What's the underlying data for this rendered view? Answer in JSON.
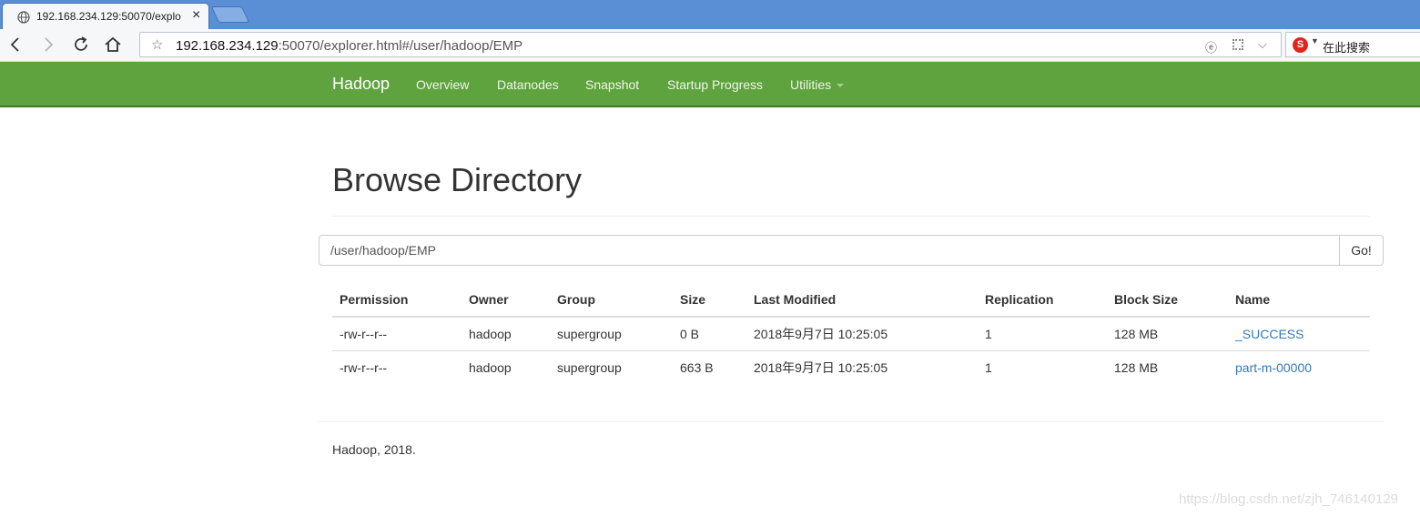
{
  "browser": {
    "tab_title": "192.168.234.129:50070/explo",
    "url_host": "192.168.234.129",
    "url_rest": ":50070/explorer.html#/user/hadoop/EMP",
    "search_placeholder": "在此搜索",
    "search_logo": "S"
  },
  "navbar": {
    "brand": "Hadoop",
    "items": [
      {
        "label": "Overview"
      },
      {
        "label": "Datanodes"
      },
      {
        "label": "Snapshot"
      },
      {
        "label": "Startup Progress"
      },
      {
        "label": "Utilities"
      }
    ],
    "accent_color": "#5fa33e"
  },
  "page": {
    "title": "Browse Directory",
    "path_value": "/user/hadoop/EMP",
    "go_label": "Go!"
  },
  "table": {
    "columns": [
      "Permission",
      "Owner",
      "Group",
      "Size",
      "Last Modified",
      "Replication",
      "Block Size",
      "Name"
    ],
    "rows": [
      {
        "permission": "-rw-r--r--",
        "owner": "hadoop",
        "group": "supergroup",
        "size": "0 B",
        "modified": "2018年9月7日 10:25:05",
        "replication": "1",
        "block_size": "128 MB",
        "name": "_SUCCESS"
      },
      {
        "permission": "-rw-r--r--",
        "owner": "hadoop",
        "group": "supergroup",
        "size": "663 B",
        "modified": "2018年9月7日 10:25:05",
        "replication": "1",
        "block_size": "128 MB",
        "name": "part-m-00000"
      }
    ]
  },
  "footer": {
    "text": "Hadoop, 2018."
  },
  "watermark": "https://blog.csdn.net/zjh_746140129"
}
